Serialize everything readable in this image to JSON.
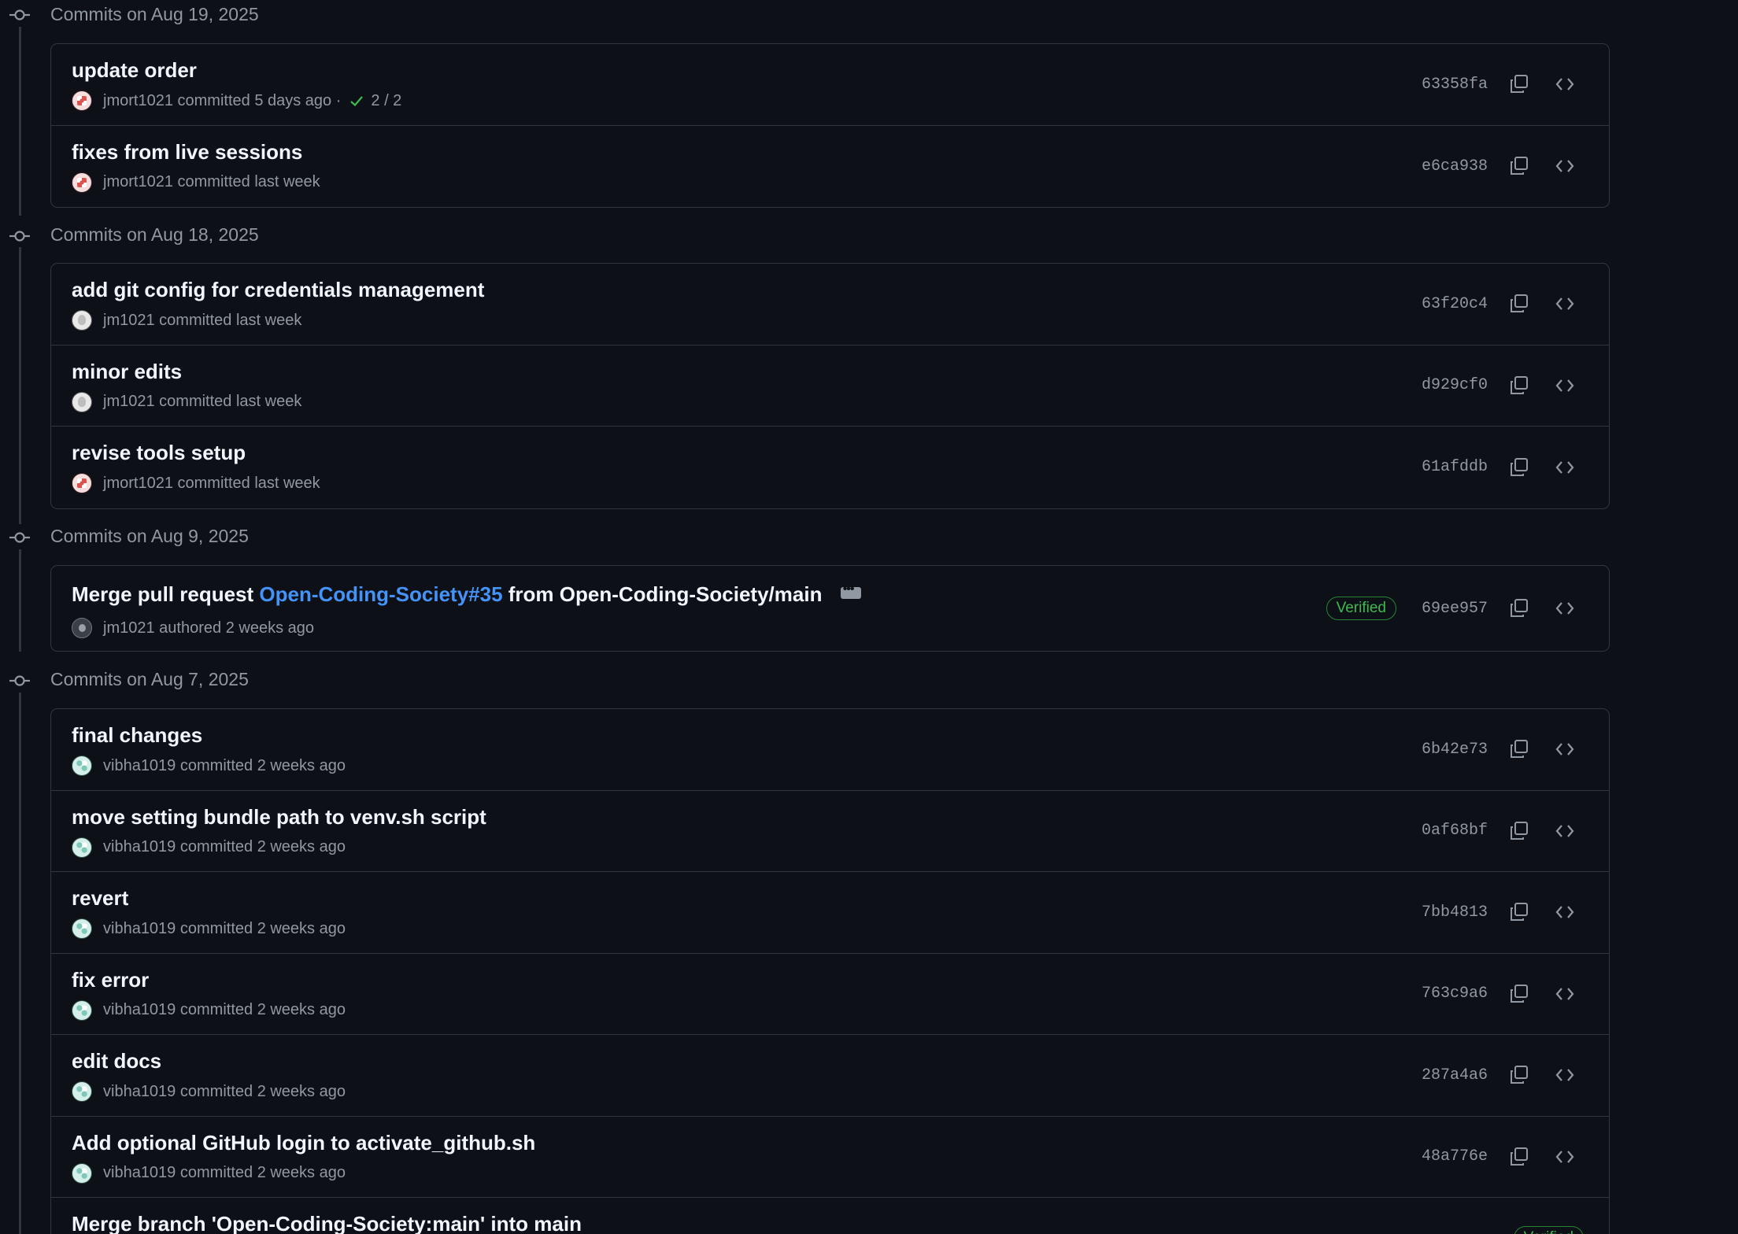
{
  "groups": [
    {
      "title": "Commits on Aug 19, 2025",
      "commits": [
        {
          "message": "update order",
          "author": "jmort1021",
          "action": "committed",
          "time": "5 days ago",
          "checks": "2 / 2",
          "sha": "63358fa"
        },
        {
          "message": "fixes from live sessions",
          "author": "jmort1021",
          "action": "committed",
          "time": "last week",
          "sha": "e6ca938"
        }
      ]
    },
    {
      "title": "Commits on Aug 18, 2025",
      "commits": [
        {
          "message": "add git config for credentials management",
          "author": "jm1021",
          "action": "committed",
          "time": "last week",
          "sha": "63f20c4"
        },
        {
          "message": "minor edits",
          "author": "jm1021",
          "action": "committed",
          "time": "last week",
          "sha": "d929cf0"
        },
        {
          "message": "revise tools setup",
          "author": "jmort1021",
          "action": "committed",
          "time": "last week",
          "sha": "61afddb"
        }
      ]
    },
    {
      "title": "Commits on Aug 9, 2025",
      "commits": [
        {
          "message_prefix": "Merge pull request ",
          "message_link": "Open-Coding-Society#35",
          "message_suffix": " from Open-Coding-Society/main",
          "author": "jm1021",
          "action": "authored",
          "time": "2 weeks ago",
          "badge": "Verified",
          "sha": "69ee957"
        }
      ]
    },
    {
      "title": "Commits on Aug 7, 2025",
      "commits": [
        {
          "message": "final changes",
          "author": "vibha1019",
          "action": "committed",
          "time": "2 weeks ago",
          "sha": "6b42e73"
        },
        {
          "message": "move setting bundle path to venv.sh script",
          "author": "vibha1019",
          "action": "committed",
          "time": "2 weeks ago",
          "sha": "0af68bf"
        },
        {
          "message": "revert",
          "author": "vibha1019",
          "action": "committed",
          "time": "2 weeks ago",
          "sha": "7bb4813"
        },
        {
          "message": "fix error",
          "author": "vibha1019",
          "action": "committed",
          "time": "2 weeks ago",
          "sha": "763c9a6"
        },
        {
          "message": "edit docs",
          "author": "vibha1019",
          "action": "committed",
          "time": "2 weeks ago",
          "sha": "287a4a6"
        },
        {
          "message": "Add optional GitHub login to activate_github.sh",
          "author": "vibha1019",
          "action": "committed",
          "time": "2 weeks ago",
          "sha": "48a776e"
        },
        {
          "message": "Merge branch 'Open-Coding-Society:main' into main",
          "badge": "Verified"
        }
      ]
    }
  ],
  "icons": {
    "timeline": "git-commit-icon",
    "copy": "copy-icon",
    "browse": "code-icon",
    "check": "check-icon",
    "expand": "kebab-horizontal-icon"
  },
  "colors": {
    "background": "#0d1117",
    "border": "#30363d",
    "muted": "#9198a1",
    "link": "#4493f8",
    "verified": "#3fb950",
    "success": "#3fb950"
  }
}
